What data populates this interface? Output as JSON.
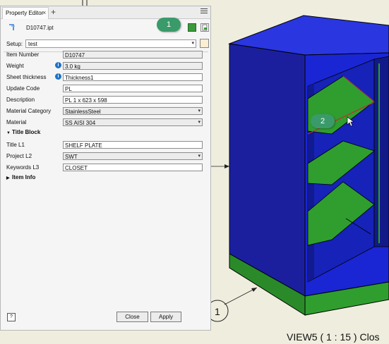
{
  "panel": {
    "tab_title": "Property Editor",
    "tab_close": "×",
    "tab_add": "+",
    "file_name": "D10747.ipt",
    "setup_label": "Setup:",
    "setup_value": "test"
  },
  "properties": [
    {
      "label": "Item Number",
      "value": "D10747",
      "info": false,
      "control": "readonly"
    },
    {
      "label": "Weight",
      "value": "3.0 kg",
      "info": true,
      "control": "readonly"
    },
    {
      "label": "Sheet thickness",
      "value": "Thickness1",
      "info": true,
      "control": "button"
    },
    {
      "label": "Update Code",
      "value": "PL",
      "info": false,
      "control": "button"
    },
    {
      "label": "Description",
      "value": "PL 1 x 623 x 598",
      "info": false,
      "control": "button"
    },
    {
      "label": "Material Category",
      "value": "StainlessSteel",
      "info": false,
      "control": "dropdown"
    },
    {
      "label": "Material",
      "value": "SS AISI 304",
      "info": false,
      "control": "dropdown"
    }
  ],
  "title_block": {
    "header": "Title Block",
    "rows": [
      {
        "label": "Title L1",
        "value": "SHELF PLATE",
        "control": "button"
      },
      {
        "label": "Project L2",
        "value": "SWT",
        "control": "dropdown"
      },
      {
        "label": "Keywords L3",
        "value": "CLOSET",
        "control": "button"
      }
    ]
  },
  "item_info": {
    "header": "Item Info"
  },
  "buttons": {
    "help": "?",
    "close": "Close",
    "apply": "Apply"
  },
  "callouts": {
    "one": "1",
    "two": "2"
  },
  "drawing": {
    "balloon": "1",
    "view_label": "VIEW5 ( 1 : 15 ) Clos"
  },
  "colors": {
    "background": "#efeede",
    "cabinet_blue": "#1a26d4",
    "shelf_green": "#2f9e2f",
    "callout_green": "#3b9a6a",
    "info_blue": "#1e72c8"
  }
}
